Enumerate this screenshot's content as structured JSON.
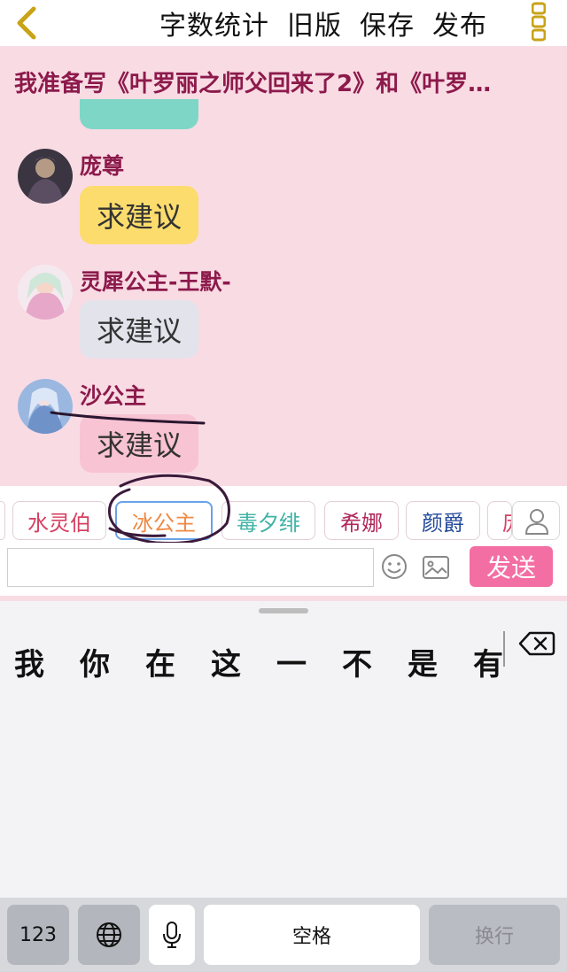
{
  "header": {
    "actions": [
      "字数统计",
      "旧版",
      "保存",
      "发布"
    ]
  },
  "chat": {
    "title": "我准备写《叶罗丽之师父回来了2》和《叶罗…",
    "messages": [
      {
        "sender": "庞尊",
        "text": "求建议",
        "bubble_color": "#fcdc6d"
      },
      {
        "sender": "灵犀公主-王默-",
        "text": "求建议",
        "bubble_color": "#e3e3ec"
      },
      {
        "sender": "沙公主",
        "text": "求建议",
        "bubble_color": "#f8c3d3"
      }
    ]
  },
  "roles": [
    {
      "name": "水灵伯",
      "color": "#d63f62"
    },
    {
      "name": "冰公主",
      "color": "#ee8a46",
      "selected": true
    },
    {
      "name": "毒夕绯",
      "color": "#3fb3a6"
    },
    {
      "name": "希娜",
      "color": "#b0285a"
    },
    {
      "name": "颜爵",
      "color": "#244a9a"
    },
    {
      "name": "庞",
      "color": "#d63f62"
    }
  ],
  "input": {
    "value": "",
    "send_label": "发送"
  },
  "keyboard": {
    "candidates": [
      "我",
      "你",
      "在",
      "这",
      "一",
      "不",
      "是",
      "有"
    ],
    "num_label": "123",
    "space_label": "空格",
    "return_label": "换行"
  },
  "colors": {
    "chat_bg": "#f9dbe4",
    "accent": "#f36ea3",
    "title": "#8c1a4b"
  }
}
